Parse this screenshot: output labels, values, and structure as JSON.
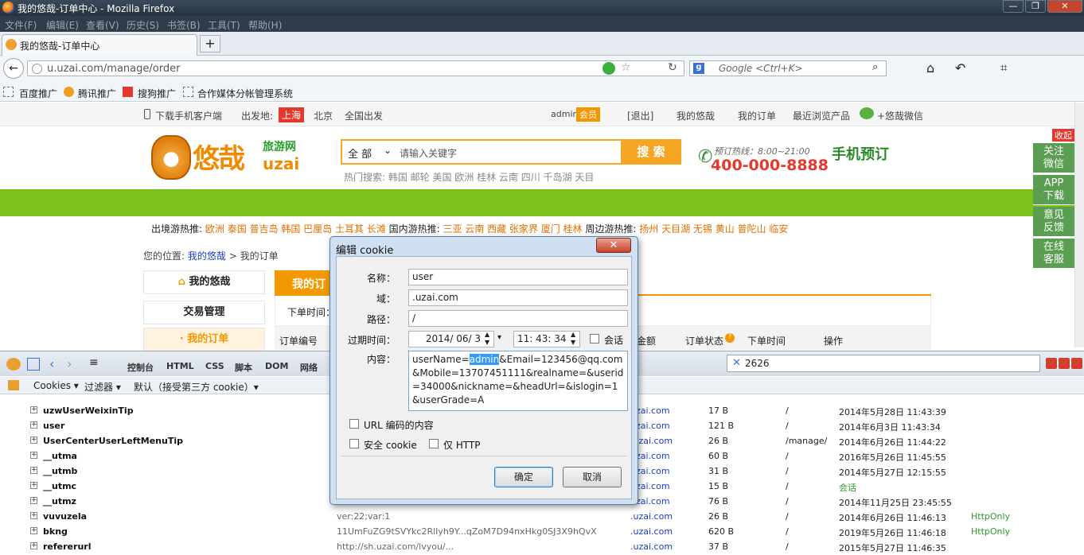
{
  "window": {
    "title": "我的悠哉-订单中心 - Mozilla Firefox",
    "controls": [
      "—",
      "❐",
      "✕"
    ]
  },
  "menu": [
    "文件(F)",
    "编辑(E)",
    "查看(V)",
    "历史(S)",
    "书签(B)",
    "工具(T)",
    "帮助(H)"
  ],
  "tab": {
    "label": "我的悠哉-订单中心",
    "new_tab": "+"
  },
  "nav": {
    "url": "u.uzai.com/manage/order",
    "search_placeholder": "Google <Ctrl+K>"
  },
  "bookmarks": [
    "百度推广",
    "腾讯推广",
    "搜狗推广",
    "合作媒体分帐管理系统"
  ],
  "topbar": {
    "download": "下载手机客户端",
    "depart_label": "出发地:",
    "depart_selected": "上海",
    "depart_other": "北京",
    "depart_all": "全国出发",
    "user": "admin",
    "vip": "会员",
    "logout": "[退出]",
    "my_uzai": "我的悠哉",
    "my_orders": "我的订单",
    "recent": "最近浏览产品",
    "wechat": "+悠哉微信"
  },
  "header": {
    "logo_main": "悠哉",
    "logo_sub1": "旅游网",
    "logo_sub2": "uzai",
    "search_category": "全 部",
    "search_placeholder": "请输入关键字",
    "search_button": "搜 索",
    "hot_search": "热门搜索: 韩国  邮轮  美国  欧洲  桂林  云南  四川  千岛湖  天目",
    "hotline_label": "预订热线：8:00~21:00",
    "hotline": "400-000-8888",
    "app_booking": "手机预订"
  },
  "hotdest": {
    "outbound_label": "出境游热推:",
    "outbound": "欧洲  泰国  普吉岛  韩国  巴厘岛  土耳其  长滩",
    "domestic_label": "国内游热推:",
    "domestic": "三亚  云南  西藏  张家界  厦门  桂林",
    "nearby_label": "周边游热推:",
    "nearby": "扬州  天目湖  无锡  黄山  普陀山  临安"
  },
  "breadcrumb": {
    "label": "您的位置:",
    "home": "我的悠哉",
    "sep": ">",
    "current": "我的订单"
  },
  "sidebar": {
    "my_uzai": "我的悠哉",
    "trade": "交易管理",
    "my_orders": "· 我的订单"
  },
  "orders": {
    "tab": "我的订",
    "filter_label": "下单时间：",
    "columns": [
      "订单编号",
      "金额",
      "订单状态",
      "下单时间",
      "操作"
    ]
  },
  "rightbar": {
    "collapse": "收起",
    "items": [
      "关注\n微信",
      "APP\n下载",
      "意见\n反馈",
      "在线\n客服"
    ]
  },
  "firebug": {
    "tabs": [
      "控制台",
      "HTML",
      "CSS",
      "脚本",
      "DOM",
      "网络"
    ],
    "filter_value": "2626",
    "sub_cookies": "Cookies ▾",
    "sub_filter": "过滤器 ▾",
    "sub_default": "默认（接受第三方 cookie）▾"
  },
  "cookies": [
    {
      "name": "uzwUserWeixinTip",
      "value": "",
      "domain": "uzai.com",
      "size": "17 B",
      "path": "/",
      "expires": "2014年5月28日 11:43:39",
      "http": ""
    },
    {
      "name": "user",
      "value": "",
      "domain": "uzai.com",
      "size": "121 B",
      "path": "/",
      "expires": "2014年6月3日 11:43:34",
      "http": ""
    },
    {
      "name": "UserCenterUserLeftMenuTip",
      "value": "",
      "domain": ".uzai.com",
      "size": "26 B",
      "path": "/manage/",
      "expires": "2014年6月26日 11:44:22",
      "http": ""
    },
    {
      "name": "__utma",
      "value": "",
      "domain": "uzai.com",
      "size": "60 B",
      "path": "/",
      "expires": "2016年5月26日 11:45:55",
      "http": ""
    },
    {
      "name": "__utmb",
      "value": "",
      "domain": "uzai.com",
      "size": "31 B",
      "path": "/",
      "expires": "2014年5月27日 12:15:55",
      "http": ""
    },
    {
      "name": "__utmc",
      "value": "",
      "domain": "uzai.com",
      "size": "15 B",
      "path": "/",
      "expires": "会话",
      "http": ""
    },
    {
      "name": "__utmz",
      "value": "",
      "domain": "uzai.com",
      "size": "76 B",
      "path": "/",
      "expires": "2014年11月25日 23:45:55",
      "http": ""
    },
    {
      "name": "vuvuzela",
      "value": "ver:22;var:1",
      "domain": ".uzai.com",
      "size": "26 B",
      "path": "/",
      "expires": "2014年6月26日 11:46:13",
      "http": "HttpOnly"
    },
    {
      "name": "bkng",
      "value": "11UmFuZG9tSVYkc2RlIyh9Y...qZoM7D94nxHkg0SJ3X9hQvX",
      "domain": ".uzai.com",
      "size": "620 B",
      "path": "/",
      "expires": "2019年5月26日 11:46:18",
      "http": "HttpOnly"
    },
    {
      "name": "refererurl",
      "value": "http://sh.uzai.com/lvyou/...",
      "domain": ".uzai.com",
      "size": "37 B",
      "path": "/",
      "expires": "2015年5月27日 11:46:35",
      "http": ""
    }
  ],
  "dialog": {
    "title": "编辑 cookie",
    "name_label": "名称：",
    "name": "user",
    "domain_label": "域：",
    "domain": ".uzai.com",
    "path_label": "路径：",
    "path": "/",
    "expires_label": "过期时间：",
    "date": "2014/ 06/  3",
    "time": "11: 43: 34",
    "session": "会话",
    "content_label": "内容：",
    "content_pre": "userName=",
    "content_sel": "admin",
    "content_post": "&Email=123456@qq.com&Mobile=13707451111&realname=&userid=34000&nickname=&headUrl=&islogin=1&userGrade=A",
    "url_encode": "URL 编码的内容",
    "secure": "安全 cookie",
    "http_only": "仅 HTTP",
    "ok": "确定",
    "cancel": "取消",
    "close": "✕"
  }
}
